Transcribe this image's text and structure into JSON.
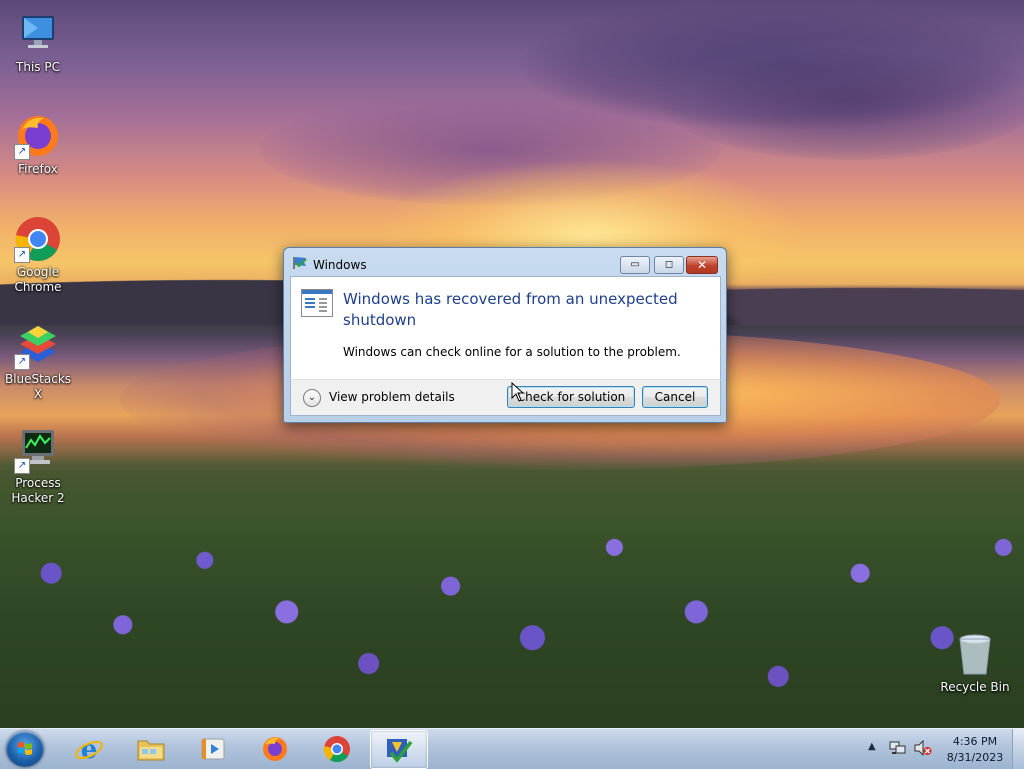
{
  "desktop": {
    "icons": [
      {
        "label": "This PC",
        "icon": "computer-icon"
      },
      {
        "label": "Firefox",
        "icon": "firefox-icon"
      },
      {
        "label": "Google Chrome",
        "icon": "chrome-icon"
      },
      {
        "label": "BlueStacks X",
        "icon": "bluestacks-icon"
      },
      {
        "label": "Process Hacker 2",
        "icon": "process-hacker-icon"
      },
      {
        "label": "Recycle Bin",
        "icon": "recycle-bin-icon"
      }
    ]
  },
  "dialog": {
    "title": "Windows",
    "heading": "Windows has recovered from an unexpected shutdown",
    "message": "Windows can check online for a solution to the problem.",
    "details_label": "View problem details",
    "primary_button": "Check for solution",
    "cancel_button": "Cancel",
    "minimize_glyph": "▭",
    "maximize_glyph": "◻",
    "close_glyph": "✕"
  },
  "taskbar": {
    "items": [
      {
        "name": "internet-explorer",
        "icon": "internet-explorer-icon"
      },
      {
        "name": "file-explorer",
        "icon": "folder-icon"
      },
      {
        "name": "media-player",
        "icon": "media-player-icon"
      },
      {
        "name": "firefox",
        "icon": "firefox-icon"
      },
      {
        "name": "chrome",
        "icon": "chrome-icon"
      },
      {
        "name": "action-center",
        "icon": "action-center-icon",
        "active": true
      }
    ],
    "tray_arrow": "▲",
    "clock": {
      "time": "4:36 PM",
      "date": "8/31/2023"
    }
  },
  "colors": {
    "heading_blue": "#1e3f8c",
    "close_red": "#c0422b",
    "taskbar": "#aabed7"
  }
}
